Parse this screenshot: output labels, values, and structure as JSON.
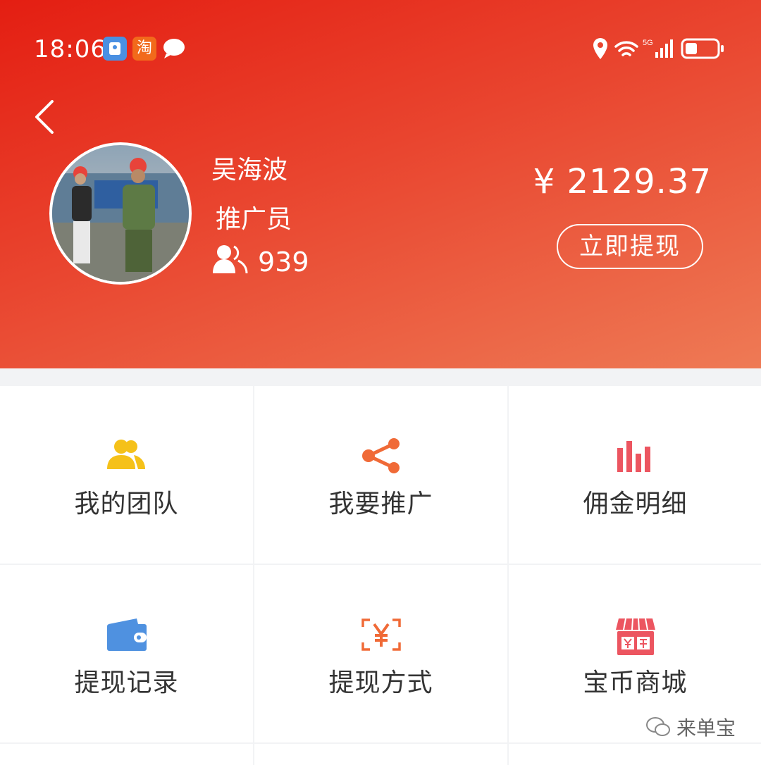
{
  "status_bar": {
    "time": "18:06",
    "taobao_glyph": "淘",
    "network": "5G"
  },
  "profile": {
    "name": "吴海波",
    "role": "推广员",
    "team_count": "939",
    "balance": "¥ 2129.37",
    "withdraw_label": "立即提现"
  },
  "menu": [
    {
      "label": "我的团队",
      "icon": "team-icon",
      "color": "#f5c119"
    },
    {
      "label": "我要推广",
      "icon": "share-icon",
      "color": "#f06a37"
    },
    {
      "label": "佣金明细",
      "icon": "bar-chart-icon",
      "color": "#ec5560"
    },
    {
      "label": "提现记录",
      "icon": "wallet-icon",
      "color": "#4f91e0"
    },
    {
      "label": "提现方式",
      "icon": "yuan-scan-icon",
      "color": "#f06a37"
    },
    {
      "label": "宝币商城",
      "icon": "shop-icon",
      "color": "#ec5560"
    }
  ],
  "watermark": "来单宝",
  "colors": {
    "header_start": "#e41e12",
    "header_end": "#ee7a55"
  }
}
